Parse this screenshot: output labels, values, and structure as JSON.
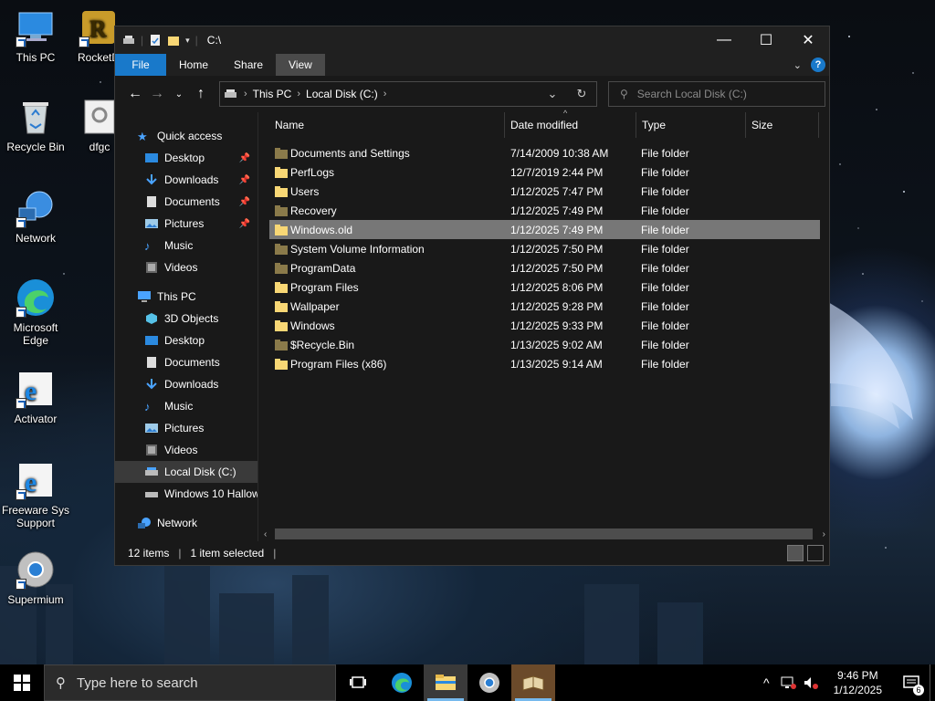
{
  "desktop": {
    "icons": [
      {
        "label": "This PC"
      },
      {
        "label": "RocketD"
      },
      {
        "label": "Recycle Bin"
      },
      {
        "label": "dfgc"
      },
      {
        "label": "Network"
      },
      {
        "label": "Microsoft Edge"
      },
      {
        "label": "Activator"
      },
      {
        "label": "Freeware Sys Support"
      },
      {
        "label": "Supermium"
      }
    ]
  },
  "window": {
    "title": "C:\\",
    "controls": {
      "minimize": "—",
      "maximize": "☐",
      "close": "✕"
    }
  },
  "ribbon": {
    "tabs": [
      {
        "label": "File"
      },
      {
        "label": "Home"
      },
      {
        "label": "Share"
      },
      {
        "label": "View"
      }
    ]
  },
  "address": {
    "segments": [
      "This PC",
      "Local Disk (C:)"
    ],
    "search_placeholder": "Search Local Disk (C:)"
  },
  "nav_pane": {
    "quick_access": "Quick access",
    "quick_items": [
      {
        "label": "Desktop",
        "pinned": true
      },
      {
        "label": "Downloads",
        "pinned": true
      },
      {
        "label": "Documents",
        "pinned": true
      },
      {
        "label": "Pictures",
        "pinned": true
      },
      {
        "label": "Music",
        "pinned": false
      },
      {
        "label": "Videos",
        "pinned": false
      }
    ],
    "this_pc": "This PC",
    "pc_items": [
      {
        "label": "3D Objects"
      },
      {
        "label": "Desktop"
      },
      {
        "label": "Documents"
      },
      {
        "label": "Downloads"
      },
      {
        "label": "Music"
      },
      {
        "label": "Pictures"
      },
      {
        "label": "Videos"
      },
      {
        "label": "Local Disk (C:)"
      },
      {
        "label": "Windows 10 Hallow"
      }
    ],
    "network": "Network"
  },
  "columns": {
    "name": "Name",
    "date": "Date modified",
    "type": "Type",
    "size": "Size"
  },
  "files": [
    {
      "name": "Documents and Settings",
      "date": "7/14/2009 10:38 AM",
      "type": "File folder"
    },
    {
      "name": "PerfLogs",
      "date": "12/7/2019 2:44 PM",
      "type": "File folder"
    },
    {
      "name": "Users",
      "date": "1/12/2025 7:47 PM",
      "type": "File folder"
    },
    {
      "name": "Recovery",
      "date": "1/12/2025 7:49 PM",
      "type": "File folder"
    },
    {
      "name": "Windows.old",
      "date": "1/12/2025 7:49 PM",
      "type": "File folder"
    },
    {
      "name": "System Volume Information",
      "date": "1/12/2025 7:50 PM",
      "type": "File folder"
    },
    {
      "name": "ProgramData",
      "date": "1/12/2025 7:50 PM",
      "type": "File folder"
    },
    {
      "name": "Program Files",
      "date": "1/12/2025 8:06 PM",
      "type": "File folder"
    },
    {
      "name": "Wallpaper",
      "date": "1/12/2025 9:28 PM",
      "type": "File folder"
    },
    {
      "name": "Windows",
      "date": "1/12/2025 9:33 PM",
      "type": "File folder"
    },
    {
      "name": "$Recycle.Bin",
      "date": "1/13/2025 9:02 AM",
      "type": "File folder"
    },
    {
      "name": "Program Files (x86)",
      "date": "1/13/2025 9:14 AM",
      "type": "File folder"
    }
  ],
  "status": {
    "count": "12 items",
    "selected": "1 item selected"
  },
  "taskbar": {
    "search_placeholder": "Type here to search",
    "time": "9:46 PM",
    "date": "1/12/2025",
    "notifications": "6"
  },
  "colors": {
    "accent": "#1979ca",
    "folder": "#f8d775",
    "background": "#191919"
  }
}
